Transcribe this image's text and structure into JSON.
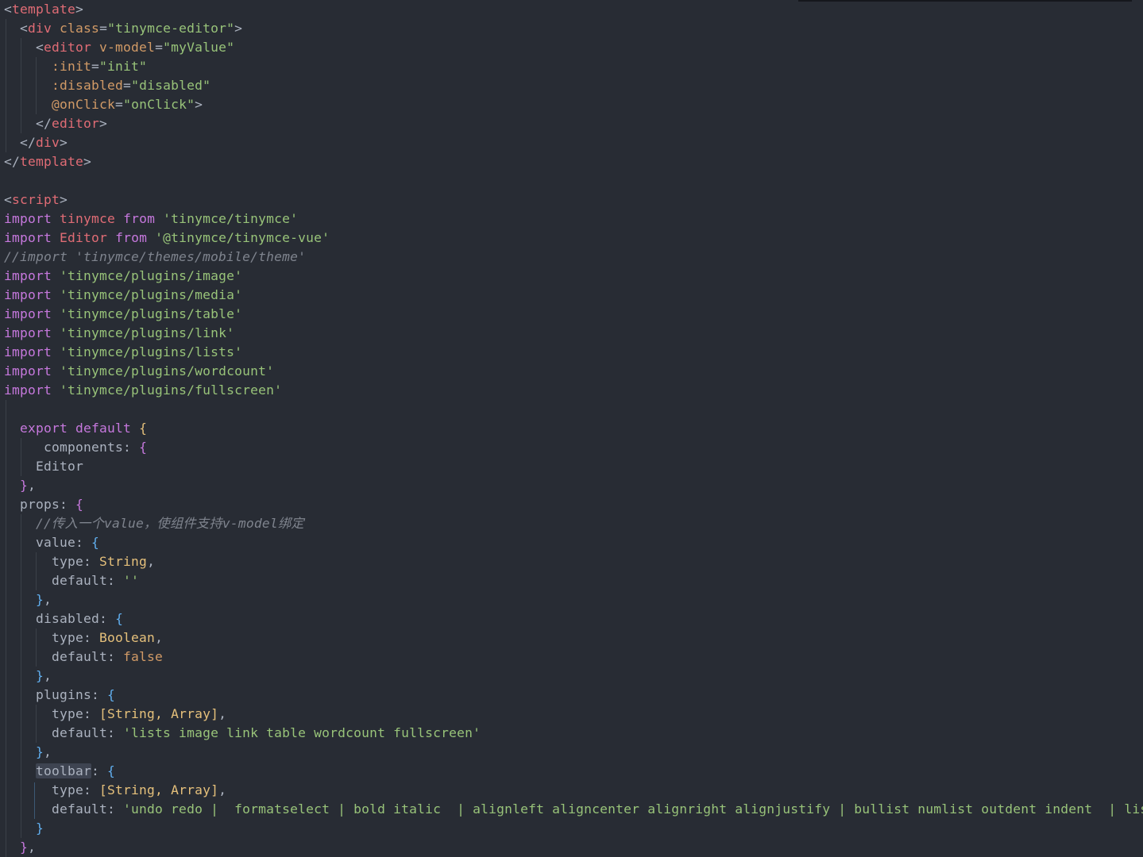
{
  "editor": {
    "lines": [
      [
        [
          "tok-plain",
          "<"
        ],
        [
          "tok-tag",
          "template"
        ],
        [
          "tok-plain",
          ">"
        ]
      ],
      [
        [
          "tok-plain",
          "  <"
        ],
        [
          "tok-tag",
          "div"
        ],
        [
          "tok-plain",
          " "
        ],
        [
          "tok-attr",
          "class"
        ],
        [
          "tok-plain",
          "="
        ],
        [
          "tok-str",
          "\"tinymce-editor\""
        ],
        [
          "tok-plain",
          ">"
        ]
      ],
      [
        [
          "tok-plain",
          "    <"
        ],
        [
          "tok-tag",
          "editor"
        ],
        [
          "tok-plain",
          " "
        ],
        [
          "tok-attr",
          "v-model"
        ],
        [
          "tok-plain",
          "="
        ],
        [
          "tok-str",
          "\"myValue\""
        ]
      ],
      [
        [
          "tok-plain",
          "      "
        ],
        [
          "tok-attr",
          ":init"
        ],
        [
          "tok-plain",
          "="
        ],
        [
          "tok-str",
          "\"init\""
        ]
      ],
      [
        [
          "tok-plain",
          "      "
        ],
        [
          "tok-attr",
          ":disabled"
        ],
        [
          "tok-plain",
          "="
        ],
        [
          "tok-str",
          "\"disabled\""
        ]
      ],
      [
        [
          "tok-plain",
          "      "
        ],
        [
          "tok-attr",
          "@onClick"
        ],
        [
          "tok-plain",
          "="
        ],
        [
          "tok-str",
          "\"onClick\""
        ],
        [
          "tok-plain",
          ">"
        ]
      ],
      [
        [
          "tok-plain",
          "    </"
        ],
        [
          "tok-tag",
          "editor"
        ],
        [
          "tok-plain",
          ">"
        ]
      ],
      [
        [
          "tok-plain",
          "  </"
        ],
        [
          "tok-tag",
          "div"
        ],
        [
          "tok-plain",
          ">"
        ]
      ],
      [
        [
          "tok-plain",
          "</"
        ],
        [
          "tok-tag",
          "template"
        ],
        [
          "tok-plain",
          ">"
        ]
      ],
      [
        [
          "tok-plain",
          ""
        ]
      ],
      [
        [
          "tok-plain",
          "<"
        ],
        [
          "tok-tag",
          "script"
        ],
        [
          "tok-plain",
          ">"
        ]
      ],
      [
        [
          "tok-kw",
          "import"
        ],
        [
          "tok-plain",
          " "
        ],
        [
          "tok-ident",
          "tinymce"
        ],
        [
          "tok-plain",
          " "
        ],
        [
          "tok-kw",
          "from"
        ],
        [
          "tok-plain",
          " "
        ],
        [
          "tok-str",
          "'tinymce/tinymce'"
        ]
      ],
      [
        [
          "tok-kw",
          "import"
        ],
        [
          "tok-plain",
          " "
        ],
        [
          "tok-ident",
          "Editor"
        ],
        [
          "tok-plain",
          " "
        ],
        [
          "tok-kw",
          "from"
        ],
        [
          "tok-plain",
          " "
        ],
        [
          "tok-str",
          "'@tinymce/tinymce-vue'"
        ]
      ],
      [
        [
          "tok-comment",
          "//import 'tinymce/themes/mobile/theme'"
        ]
      ],
      [
        [
          "tok-kw",
          "import"
        ],
        [
          "tok-plain",
          " "
        ],
        [
          "tok-str",
          "'tinymce/plugins/image'"
        ]
      ],
      [
        [
          "tok-kw",
          "import"
        ],
        [
          "tok-plain",
          " "
        ],
        [
          "tok-str",
          "'tinymce/plugins/media'"
        ]
      ],
      [
        [
          "tok-kw",
          "import"
        ],
        [
          "tok-plain",
          " "
        ],
        [
          "tok-str",
          "'tinymce/plugins/table'"
        ]
      ],
      [
        [
          "tok-kw",
          "import"
        ],
        [
          "tok-plain",
          " "
        ],
        [
          "tok-str",
          "'tinymce/plugins/link'"
        ]
      ],
      [
        [
          "tok-kw",
          "import"
        ],
        [
          "tok-plain",
          " "
        ],
        [
          "tok-str",
          "'tinymce/plugins/lists'"
        ]
      ],
      [
        [
          "tok-kw",
          "import"
        ],
        [
          "tok-plain",
          " "
        ],
        [
          "tok-str",
          "'tinymce/plugins/wordcount'"
        ]
      ],
      [
        [
          "tok-kw",
          "import"
        ],
        [
          "tok-plain",
          " "
        ],
        [
          "tok-str",
          "'tinymce/plugins/fullscreen'"
        ]
      ],
      [
        [
          "tok-plain",
          ""
        ]
      ],
      [
        [
          "tok-plain",
          "  "
        ],
        [
          "tok-kw",
          "export"
        ],
        [
          "tok-plain",
          " "
        ],
        [
          "tok-kw",
          "default"
        ],
        [
          "tok-plain",
          " "
        ],
        [
          "tok-type",
          "{"
        ]
      ],
      [
        [
          "tok-plain",
          "     "
        ],
        [
          "tok-prop",
          "components"
        ],
        [
          "tok-plain",
          ": "
        ],
        [
          "tok-brace2",
          "{"
        ]
      ],
      [
        [
          "tok-plain",
          "    "
        ],
        [
          "tok-prop",
          "Editor"
        ]
      ],
      [
        [
          "tok-plain",
          "  "
        ],
        [
          "tok-brace2",
          "}"
        ],
        [
          "tok-plain",
          ","
        ]
      ],
      [
        [
          "tok-plain",
          "  "
        ],
        [
          "tok-prop",
          "props"
        ],
        [
          "tok-plain",
          ": "
        ],
        [
          "tok-brace2",
          "{"
        ]
      ],
      [
        [
          "tok-plain",
          "    "
        ],
        [
          "tok-comment",
          "//传入一个value，使组件支持v-model绑定"
        ]
      ],
      [
        [
          "tok-plain",
          "    "
        ],
        [
          "tok-prop",
          "value"
        ],
        [
          "tok-plain",
          ": "
        ],
        [
          "tok-brace3",
          "{"
        ]
      ],
      [
        [
          "tok-plain",
          "      "
        ],
        [
          "tok-prop",
          "type"
        ],
        [
          "tok-plain",
          ": "
        ],
        [
          "tok-type",
          "String"
        ],
        [
          "tok-plain",
          ","
        ]
      ],
      [
        [
          "tok-plain",
          "      "
        ],
        [
          "tok-prop",
          "default"
        ],
        [
          "tok-plain",
          ": "
        ],
        [
          "tok-str",
          "''"
        ]
      ],
      [
        [
          "tok-plain",
          "    "
        ],
        [
          "tok-brace3",
          "}"
        ],
        [
          "tok-plain",
          ","
        ]
      ],
      [
        [
          "tok-plain",
          "    "
        ],
        [
          "tok-prop",
          "disabled"
        ],
        [
          "tok-plain",
          ": "
        ],
        [
          "tok-brace3",
          "{"
        ]
      ],
      [
        [
          "tok-plain",
          "      "
        ],
        [
          "tok-prop",
          "type"
        ],
        [
          "tok-plain",
          ": "
        ],
        [
          "tok-type",
          "Boolean"
        ],
        [
          "tok-plain",
          ","
        ]
      ],
      [
        [
          "tok-plain",
          "      "
        ],
        [
          "tok-prop",
          "default"
        ],
        [
          "tok-plain",
          ": "
        ],
        [
          "tok-bool",
          "false"
        ]
      ],
      [
        [
          "tok-plain",
          "    "
        ],
        [
          "tok-brace3",
          "}"
        ],
        [
          "tok-plain",
          ","
        ]
      ],
      [
        [
          "tok-plain",
          "    "
        ],
        [
          "tok-prop",
          "plugins"
        ],
        [
          "tok-plain",
          ": "
        ],
        [
          "tok-brace3",
          "{"
        ]
      ],
      [
        [
          "tok-plain",
          "      "
        ],
        [
          "tok-prop",
          "type"
        ],
        [
          "tok-plain",
          ": "
        ],
        [
          "tok-type",
          "[String, Array]"
        ],
        [
          "tok-plain",
          ","
        ]
      ],
      [
        [
          "tok-plain",
          "      "
        ],
        [
          "tok-prop",
          "default"
        ],
        [
          "tok-plain",
          ": "
        ],
        [
          "tok-str",
          "'lists image link table wordcount fullscreen'"
        ]
      ],
      [
        [
          "tok-plain",
          "    "
        ],
        [
          "tok-brace3",
          "}"
        ],
        [
          "tok-plain",
          ","
        ]
      ],
      [
        [
          "tok-plain",
          "    "
        ],
        [
          "tok-highlight",
          "toolbar"
        ],
        [
          "tok-plain",
          ": "
        ],
        [
          "tok-brace3",
          "{"
        ]
      ],
      [
        [
          "tok-plain",
          "      "
        ],
        [
          "tok-prop",
          "type"
        ],
        [
          "tok-plain",
          ": "
        ],
        [
          "tok-type",
          "[String, Array]"
        ],
        [
          "tok-plain",
          ","
        ]
      ],
      [
        [
          "tok-plain",
          "      "
        ],
        [
          "tok-prop",
          "default"
        ],
        [
          "tok-plain",
          ": "
        ],
        [
          "tok-str",
          "'undo redo |  formatselect | bold italic  | alignleft aligncenter alignright alignjustify | bullist numlist outdent indent  | lists image media table | removeformat'"
        ]
      ],
      [
        [
          "tok-plain",
          "    "
        ],
        [
          "tok-brace3",
          "}"
        ]
      ],
      [
        [
          "tok-plain",
          "  "
        ],
        [
          "tok-brace2",
          "}"
        ],
        [
          "tok-plain",
          ","
        ]
      ]
    ]
  }
}
